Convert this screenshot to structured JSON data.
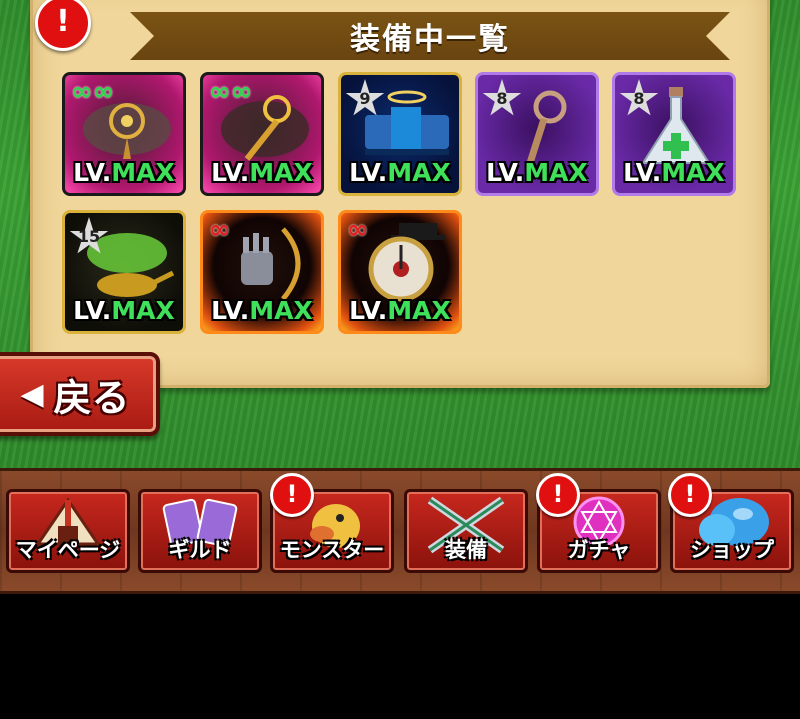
{
  "header": {
    "alert": "!",
    "title": "装備中一覧"
  },
  "equipment": [
    {
      "level_prefix": "LV.",
      "level_value": "MAX",
      "badge": "∞∞",
      "frame": "pink"
    },
    {
      "level_prefix": "LV.",
      "level_value": "MAX",
      "badge": "∞∞",
      "frame": "pink"
    },
    {
      "level_prefix": "LV.",
      "level_value": "MAX",
      "star": "9",
      "frame": "blue"
    },
    {
      "level_prefix": "LV.",
      "level_value": "MAX",
      "star": "8",
      "frame": "purple"
    },
    {
      "level_prefix": "LV.",
      "level_value": "MAX",
      "star": "8",
      "frame": "purple"
    },
    {
      "level_prefix": "LV.",
      "level_value": "MAX",
      "star": "15",
      "frame": "dark"
    },
    {
      "level_prefix": "LV.",
      "level_value": "MAX",
      "badge": "∞",
      "frame": "fire"
    },
    {
      "level_prefix": "LV.",
      "level_value": "MAX",
      "badge": "∞",
      "frame": "fire"
    }
  ],
  "back_button": {
    "arrow": "◀",
    "label": "戻る"
  },
  "nav": {
    "alert": "!",
    "items": [
      {
        "label": "マイページ",
        "icon": "tent-icon",
        "has_alert": false
      },
      {
        "label": "ギルド",
        "icon": "guild-cards-icon",
        "has_alert": false
      },
      {
        "label": "モンスター",
        "icon": "monster-icon",
        "has_alert": true
      },
      {
        "label": "装備",
        "icon": "crossed-swords-icon",
        "has_alert": false
      },
      {
        "label": "ガチャ",
        "icon": "magic-circle-icon",
        "has_alert": true
      },
      {
        "label": "ショップ",
        "icon": "crystal-icon",
        "has_alert": true
      }
    ]
  },
  "colors": {
    "accent_red": "#c8281e",
    "level_green": "#3fe05a",
    "banner_brown": "#7a5314",
    "parchment": "#f0d69a"
  }
}
